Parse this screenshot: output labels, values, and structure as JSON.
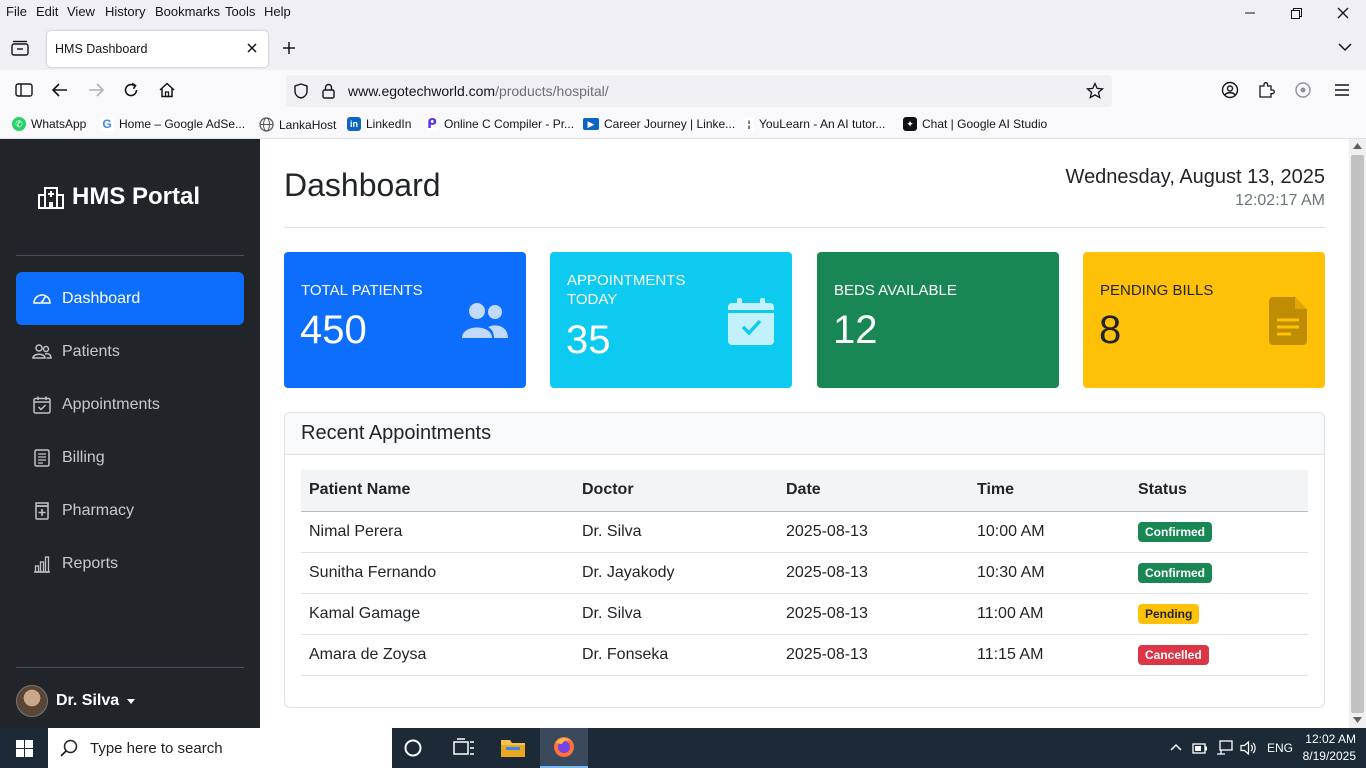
{
  "menu": [
    "File",
    "Edit",
    "View",
    "History",
    "Bookmarks",
    "Tools",
    "Help"
  ],
  "tab": {
    "title": "HMS Dashboard"
  },
  "url": {
    "host": "www.egotechworld.com",
    "path": "/products/hospital/"
  },
  "bookmarks": [
    {
      "label": "WhatsApp",
      "icon": "whatsapp-icon",
      "color": "#25d366"
    },
    {
      "label": "Home – Google AdSe...",
      "icon": "google-icon",
      "color": "#4285f4"
    },
    {
      "label": "LankaHost",
      "icon": "globe-icon",
      "color": "#555555"
    },
    {
      "label": "LinkedIn",
      "icon": "linkedin-icon",
      "color": "#0a66c2"
    },
    {
      "label": "Online C Compiler - Pr...",
      "icon": "compiler-icon",
      "color": "#5b2ee6"
    },
    {
      "label": "Career Journey | Linke...",
      "icon": "video-icon",
      "color": "#0a66c2"
    },
    {
      "label": "YouLearn - An AI tutor...",
      "icon": "youlearn-icon",
      "color": "#222222"
    },
    {
      "label": "Chat | Google AI Studio",
      "icon": "aistudio-icon",
      "color": "#111111"
    }
  ],
  "sidebar": {
    "brand": "HMS Portal",
    "items": [
      {
        "label": "Dashboard",
        "active": true
      },
      {
        "label": "Patients"
      },
      {
        "label": "Appointments"
      },
      {
        "label": "Billing"
      },
      {
        "label": "Pharmacy"
      },
      {
        "label": "Reports"
      }
    ],
    "user": "Dr. Silva"
  },
  "main": {
    "title": "Dashboard",
    "date": "Wednesday, August 13, 2025",
    "time": "12:02:17 AM",
    "cards": [
      {
        "label": "TOTAL PATIENTS",
        "value": "450",
        "color": "#0d6efd",
        "icon": "users-icon"
      },
      {
        "label": "APPOINTMENTS TODAY",
        "value": "35",
        "color": "#0dcaf0",
        "icon": "calendar-check-icon"
      },
      {
        "label": "BEDS AVAILABLE",
        "value": "12",
        "color": "#198754",
        "icon": "bed-icon"
      },
      {
        "label": "PENDING BILLS",
        "value": "8",
        "color": "#ffc107",
        "icon": "file-text-icon"
      }
    ],
    "recent": {
      "title": "Recent Appointments",
      "columns": [
        "Patient Name",
        "Doctor",
        "Date",
        "Time",
        "Status"
      ],
      "rows": [
        {
          "patient": "Nimal Perera",
          "doctor": "Dr. Silva",
          "date": "2025-08-13",
          "time": "10:00 AM",
          "status": "Confirmed"
        },
        {
          "patient": "Sunitha Fernando",
          "doctor": "Dr. Jayakody",
          "date": "2025-08-13",
          "time": "10:30 AM",
          "status": "Confirmed"
        },
        {
          "patient": "Kamal Gamage",
          "doctor": "Dr. Silva",
          "date": "2025-08-13",
          "time": "11:00 AM",
          "status": "Pending"
        },
        {
          "patient": "Amara de Zoysa",
          "doctor": "Dr. Fonseka",
          "date": "2025-08-13",
          "time": "11:15 AM",
          "status": "Cancelled"
        }
      ]
    }
  },
  "taskbar": {
    "search_placeholder": "Type here to search",
    "lang": "ENG",
    "clock_time": "12:02 AM",
    "clock_date": "8/19/2025"
  }
}
